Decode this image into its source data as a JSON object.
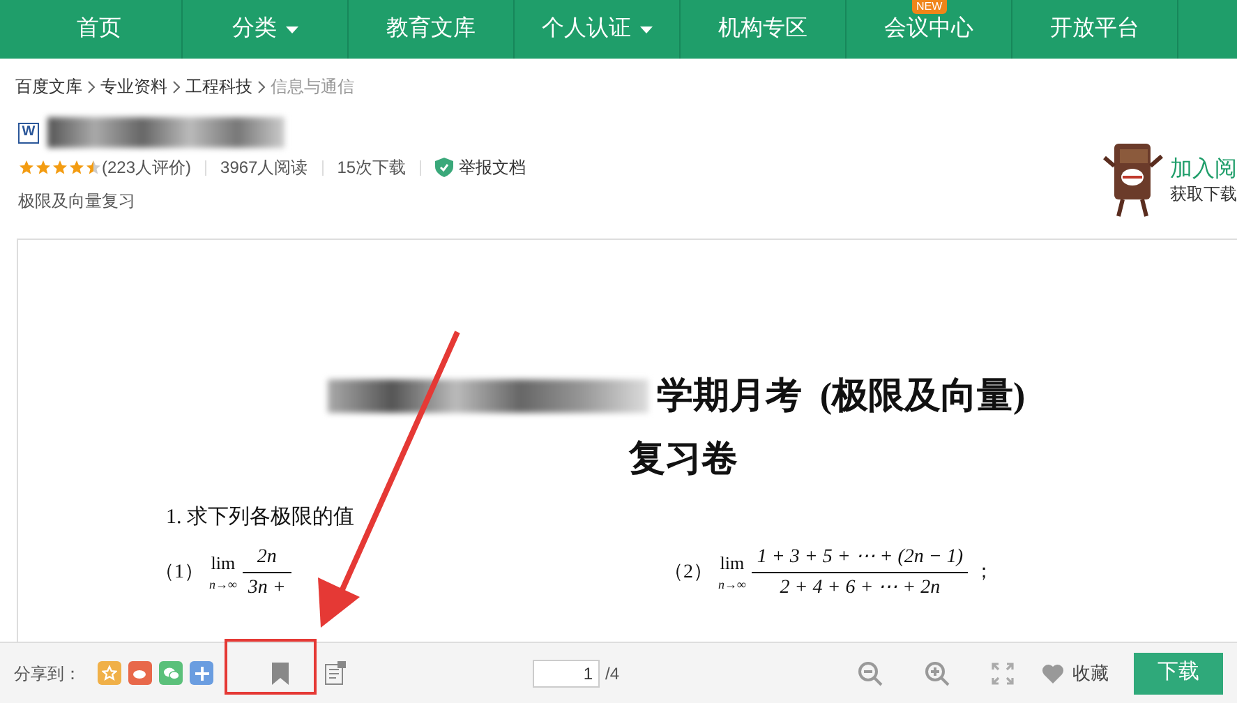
{
  "nav": {
    "items": [
      {
        "label": "首页",
        "dropdown": false
      },
      {
        "label": "分类",
        "dropdown": true
      },
      {
        "label": "教育文库",
        "dropdown": false
      },
      {
        "label": "个人认证",
        "dropdown": true
      },
      {
        "label": "机构专区",
        "dropdown": false
      },
      {
        "label": "会议中心",
        "dropdown": false,
        "badge": "NEW"
      },
      {
        "label": "开放平台",
        "dropdown": false
      }
    ]
  },
  "breadcrumb": [
    "百度文库",
    "专业资料",
    "工程科技",
    "信息与通信"
  ],
  "document": {
    "file_badge": "W",
    "stars": 4.5,
    "rating": "(223人评价)",
    "reads": "3967人阅读",
    "downloads": "15次下载",
    "report": "举报文档",
    "subtitle": "极限及向量复习"
  },
  "promo": {
    "title": "加入阅",
    "subtitle": "获取下载"
  },
  "page": {
    "heading": "学期月考  (极限及向量)",
    "heading2": "复习卷",
    "question": "1. 求下列各极限的值",
    "items": [
      {
        "label": "（1）",
        "lim": "lim",
        "sub": "n→∞",
        "numerator": "2n",
        "denominator": "3n +"
      },
      {
        "label": "（2）",
        "lim": "lim",
        "sub": "n→∞",
        "numerator": "1 + 3 + 5 + ⋯ + (2n − 1)",
        "denominator": "2 + 4 + 6 + ⋯ + 2n",
        "tail": "；"
      }
    ]
  },
  "toolbar": {
    "share_label": "分享到：",
    "page_value": "1",
    "page_total": "/4",
    "favorite": "收藏",
    "download": "下载"
  }
}
